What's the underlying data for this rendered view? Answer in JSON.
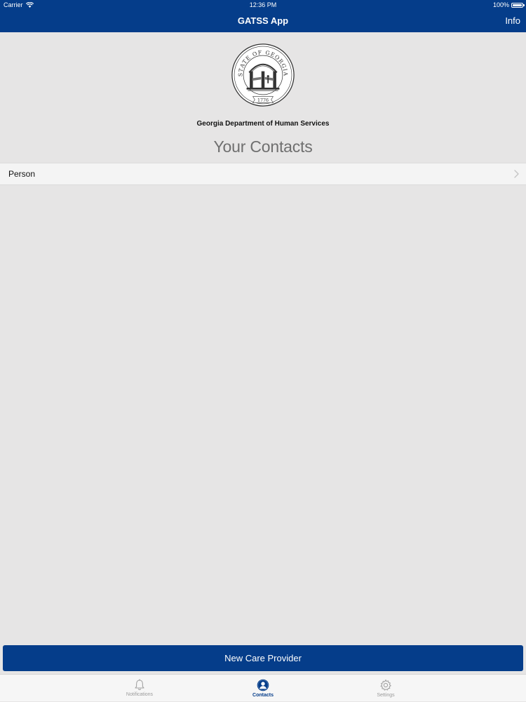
{
  "status_bar": {
    "carrier": "Carrier",
    "time": "12:36 PM",
    "battery": "100%"
  },
  "nav": {
    "title": "GATSS App",
    "info_label": "Info"
  },
  "seal": {
    "top_text": "STATE OF GEORGIA",
    "year": "1776"
  },
  "header": {
    "department": "Georgia Department of Human Services",
    "section_title": "Your Contacts"
  },
  "contacts": [
    {
      "name": "Person"
    }
  ],
  "primary_button": {
    "label": "New Care Provider"
  },
  "tabs": [
    {
      "label": "Notifications",
      "icon": "bell-icon",
      "active": false
    },
    {
      "label": "Contacts",
      "icon": "person-icon",
      "active": true
    },
    {
      "label": "Settings",
      "icon": "gear-icon",
      "active": false
    }
  ],
  "colors": {
    "brand_blue": "#053d8a",
    "background": "#e6e5e5",
    "row_background": "#f4f4f4",
    "inactive_tab": "#9a9a9a"
  }
}
